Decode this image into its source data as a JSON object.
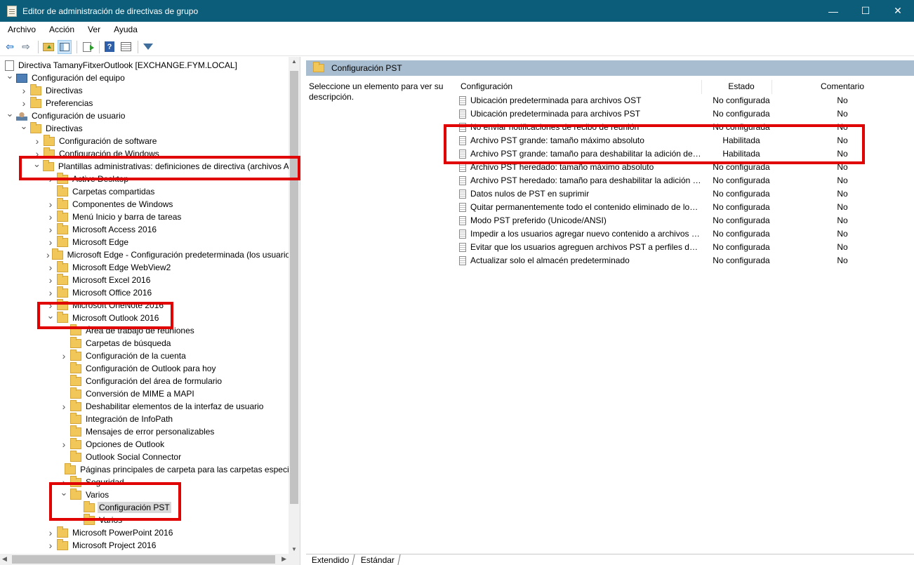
{
  "window": {
    "title": "Editor de administración de directivas de grupo",
    "minimize": "—",
    "maximize": "☐",
    "close": "✕"
  },
  "menu": [
    "Archivo",
    "Acción",
    "Ver",
    "Ayuda"
  ],
  "tree": {
    "root": "Directiva TamanyFitxerOutlook [EXCHANGE.FYM.LOCAL]",
    "items": [
      "Configuración del equipo",
      "Directivas",
      "Preferencias",
      "Configuración de usuario",
      "Directivas",
      "Configuración de software",
      "Configuración de Windows",
      "Plantillas administrativas: definiciones de directiva (archivos ADMX) recuperadas del equipo local",
      "Active Desktop",
      "Carpetas compartidas",
      "Componentes de Windows",
      "Menú Inicio y barra de tareas",
      "Microsoft Access 2016",
      "Microsoft Edge",
      "Microsoft Edge - Configuración predeterminada (los usuarios pueden invalidarla)",
      "Microsoft Edge WebView2",
      "Microsoft Excel 2016",
      "Microsoft Office 2016",
      "Microsoft OneNote 2016",
      "Microsoft Outlook 2016",
      "Área de trabajo de reuniones",
      "Carpetas de búsqueda",
      "Configuración de la cuenta",
      "Configuración de Outlook para hoy",
      "Configuración del área de formulario",
      "Conversión de MIME a MAPI",
      "Deshabilitar elementos de la interfaz de usuario",
      "Integración de InfoPath",
      "Mensajes de error personalizables",
      "Opciones de Outlook",
      "Outlook Social Connector",
      "Páginas principales de carpeta para las carpetas especiales de Outlook",
      "Seguridad",
      "Varios",
      "Configuración PST",
      "Varios",
      "Microsoft PowerPoint 2016",
      "Microsoft Project 2016"
    ]
  },
  "right": {
    "header": "Configuración PST",
    "description": "Seleccione un elemento para ver su descripción.",
    "columns": {
      "setting": "Configuración",
      "state": "Estado",
      "comment": "Comentario"
    },
    "rows": [
      {
        "name": "Ubicación predeterminada para archivos OST",
        "state": "No configurada",
        "comment": "No"
      },
      {
        "name": "Ubicación predeterminada para archivos PST",
        "state": "No configurada",
        "comment": "No"
      },
      {
        "name": "No enviar notificaciones de recibo de reunión",
        "state": "No configurada",
        "comment": "No"
      },
      {
        "name": "Archivo PST grande: tamaño máximo absoluto",
        "state": "Habilitada",
        "comment": "No"
      },
      {
        "name": "Archivo PST grande: tamaño para deshabilitar la adición de contenido",
        "state": "Habilitada",
        "comment": "No"
      },
      {
        "name": "Archivo PST heredado: tamaño máximo absoluto",
        "state": "No configurada",
        "comment": "No"
      },
      {
        "name": "Archivo PST heredado: tamaño para deshabilitar la adición de contenido",
        "state": "No configurada",
        "comment": "No"
      },
      {
        "name": "Datos nulos de PST en suprimir",
        "state": "No configurada",
        "comment": "No"
      },
      {
        "name": "Quitar permanentemente todo el contenido eliminado de los archivos PST",
        "state": "No configurada",
        "comment": "No"
      },
      {
        "name": "Modo PST preferido (Unicode/ANSI)",
        "state": "No configurada",
        "comment": "No"
      },
      {
        "name": "Impedir a los usuarios agregar nuevo contenido a archivos PST existentes",
        "state": "No configurada",
        "comment": "No"
      },
      {
        "name": "Evitar que los usuarios agreguen archivos PST a perfiles de Outlook",
        "state": "No configurada",
        "comment": "No"
      },
      {
        "name": "Actualizar solo el almacén predeterminado",
        "state": "No configurada",
        "comment": "No"
      }
    ],
    "tabs": [
      "Extendido",
      "Estándar"
    ]
  }
}
